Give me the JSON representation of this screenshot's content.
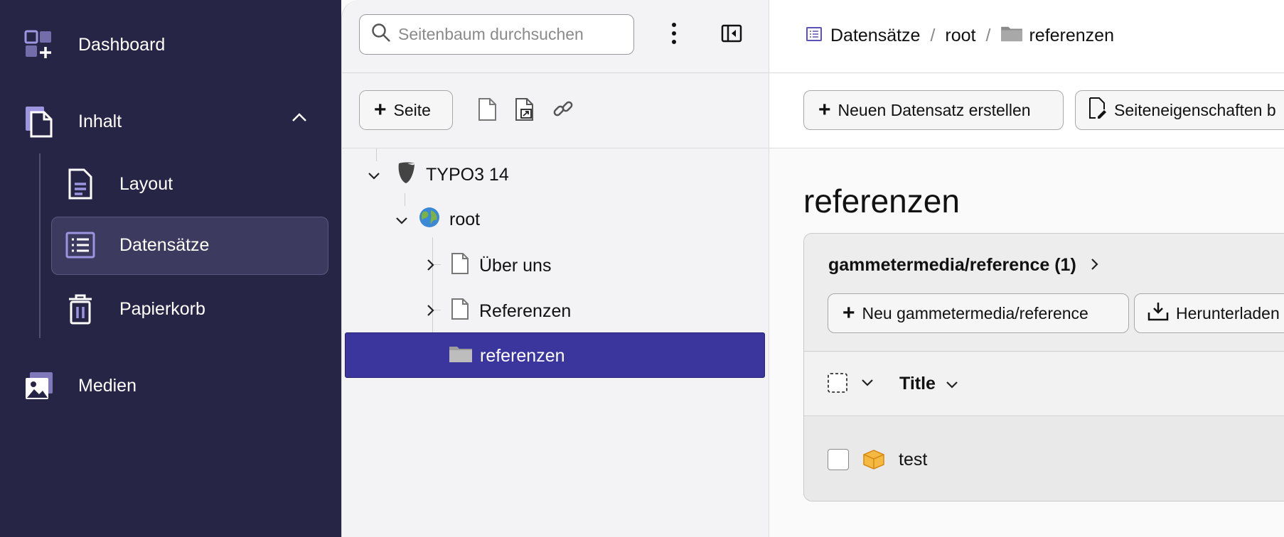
{
  "sidebar": {
    "items": [
      {
        "label": "Dashboard",
        "icon": "dashboard-icon"
      },
      {
        "label": "Inhalt",
        "icon": "content-icon"
      },
      {
        "label": "Layout",
        "icon": "layout-icon"
      },
      {
        "label": "Datensätze",
        "icon": "records-icon"
      },
      {
        "label": "Papierkorb",
        "icon": "trash-icon"
      },
      {
        "label": "Medien",
        "icon": "media-icon"
      }
    ],
    "accent": "#9d95e0"
  },
  "tree": {
    "search_placeholder": "Seitenbaum durchsuchen",
    "new_page_label": "Seite",
    "nodes": [
      {
        "label": "TYPO3 14",
        "icon": "typo3-icon"
      },
      {
        "label": "root",
        "icon": "globe-icon"
      },
      {
        "label": "Über uns",
        "icon": "page-icon"
      },
      {
        "label": "Referenzen",
        "icon": "page-icon"
      },
      {
        "label": "referenzen",
        "icon": "folder-icon"
      }
    ],
    "selected_color": "#3b359e"
  },
  "breadcrumb": {
    "items": [
      "Datensätze",
      "root",
      "referenzen"
    ],
    "separator": "/"
  },
  "toolbar": {
    "new_record_label": "Neuen Datensatz erstellen",
    "page_props_label": "Seiteneigenschaften b"
  },
  "page_title": "referenzen",
  "record_panel": {
    "title": "gammetermedia/reference (1)",
    "new_label": "Neu gammetermedia/reference",
    "download_label": "Herunterladen",
    "column_title": "Title",
    "rows": [
      {
        "title": "test",
        "icon": "record-box-icon"
      }
    ]
  }
}
